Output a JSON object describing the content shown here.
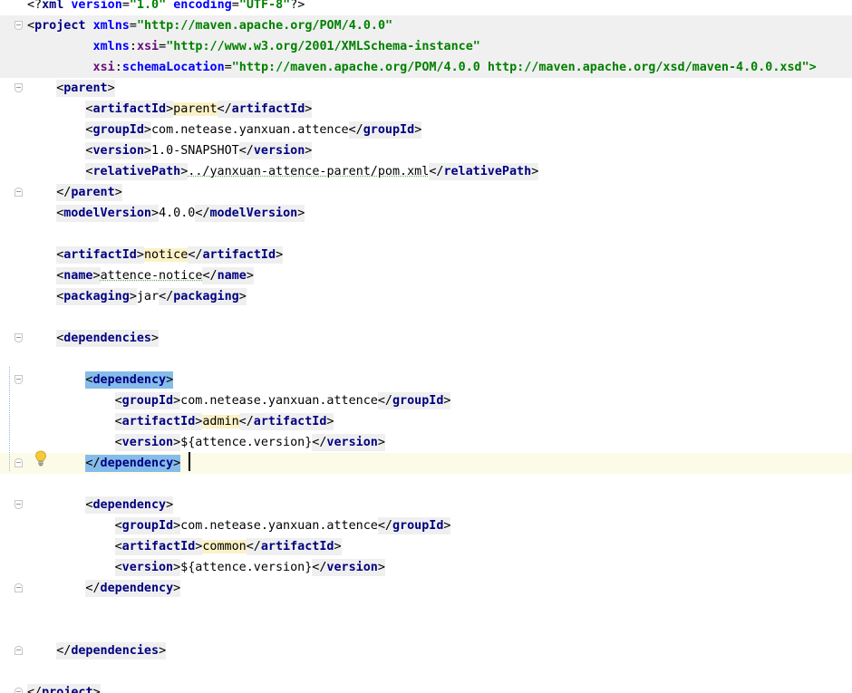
{
  "editor": {
    "file_type": "xml",
    "caret_line": 23,
    "lines": [
      {
        "fold": "none",
        "bg": false,
        "indent": 0,
        "tokens": [
          {
            "t": "<?",
            "c": "pi"
          },
          {
            "t": "xml ",
            "c": "tag"
          },
          {
            "t": "version",
            "c": "attr"
          },
          {
            "t": "=",
            "c": "pi"
          },
          {
            "t": "\"1.0\" ",
            "c": "str"
          },
          {
            "t": "encoding",
            "c": "attr"
          },
          {
            "t": "=",
            "c": "pi"
          },
          {
            "t": "\"UTF-8\"",
            "c": "str"
          },
          {
            "t": "?>",
            "c": "pi"
          }
        ]
      },
      {
        "fold": "start",
        "bg": true,
        "indent": 0,
        "tokens": [
          {
            "t": "<",
            "c": "br"
          },
          {
            "t": "project ",
            "c": "tag"
          },
          {
            "t": "xmlns",
            "c": "attr"
          },
          {
            "t": "=",
            "c": "pi"
          },
          {
            "t": "\"http://maven.apache.org/POM/4.0.0\"",
            "c": "str"
          }
        ]
      },
      {
        "fold": "none",
        "bg": true,
        "indent": 0,
        "tokens": [
          {
            "t": "         xmlns",
            "c": "attr"
          },
          {
            "t": ":",
            "c": "pi"
          },
          {
            "t": "xsi",
            "c": "ns"
          },
          {
            "t": "=",
            "c": "pi"
          },
          {
            "t": "\"http://www.w3.org/2001/XMLSchema-instance\"",
            "c": "str"
          }
        ]
      },
      {
        "fold": "none",
        "bg": true,
        "indent": 0,
        "tokens": [
          {
            "t": "         xsi",
            "c": "ns"
          },
          {
            "t": ":",
            "c": "pi"
          },
          {
            "t": "schemaLocation",
            "c": "attr"
          },
          {
            "t": "=",
            "c": "pi"
          },
          {
            "t": "\"http://maven.apache.org/POM/4.0.0 http://maven.apache.org/xsd/maven-4.0.0.xsd\">",
            "c": "str"
          }
        ]
      },
      {
        "fold": "start",
        "bg": false,
        "indent": 1,
        "box": true,
        "open": "parent"
      },
      {
        "fold": "none",
        "bg": false,
        "indent": 2,
        "elem": "artifactId",
        "value": "parent",
        "vh": true
      },
      {
        "fold": "none",
        "bg": false,
        "indent": 2,
        "elem": "groupId",
        "value": "com.netease.yanxuan.attence"
      },
      {
        "fold": "none",
        "bg": false,
        "indent": 2,
        "elem": "version",
        "value": "1.0-SNAPSHOT"
      },
      {
        "fold": "none",
        "bg": false,
        "indent": 2,
        "elem": "relativePath",
        "value": "../yanxuan-attence-parent/pom.xml",
        "squiggle": true
      },
      {
        "fold": "end",
        "bg": false,
        "indent": 1,
        "box": true,
        "close": "parent"
      },
      {
        "fold": "none",
        "bg": false,
        "indent": 1,
        "elem": "modelVersion",
        "value": "4.0.0"
      },
      {
        "fold": "none",
        "bg": false,
        "indent": 0,
        "blank": true
      },
      {
        "fold": "none",
        "bg": false,
        "indent": 1,
        "elem": "artifactId",
        "value": "notice",
        "vh": true
      },
      {
        "fold": "none",
        "bg": false,
        "indent": 1,
        "elem": "name",
        "value": "attence-notice",
        "squiggle": true
      },
      {
        "fold": "none",
        "bg": false,
        "indent": 1,
        "elem": "packaging",
        "value": "jar"
      },
      {
        "fold": "none",
        "bg": false,
        "indent": 0,
        "blank": true
      },
      {
        "fold": "start",
        "bg": false,
        "indent": 1,
        "box": true,
        "open": "dependencies"
      },
      {
        "fold": "none",
        "bg": false,
        "indent": 0,
        "blank": true
      },
      {
        "fold": "start",
        "bg": false,
        "indent": 2,
        "box": true,
        "open": "dependency",
        "sel": true
      },
      {
        "fold": "none",
        "bg": false,
        "indent": 3,
        "elem": "groupId",
        "value": "com.netease.yanxuan.attence"
      },
      {
        "fold": "none",
        "bg": false,
        "indent": 3,
        "elem": "artifactId",
        "value": "admin",
        "vh": true
      },
      {
        "fold": "none",
        "bg": false,
        "indent": 3,
        "elem": "version",
        "value": "${attence.version}"
      },
      {
        "fold": "end",
        "bg": false,
        "indent": 2,
        "box": true,
        "close": "dependency",
        "sel": true,
        "caret": true
      },
      {
        "fold": "none",
        "bg": false,
        "indent": 0,
        "blank": true
      },
      {
        "fold": "start",
        "bg": false,
        "indent": 2,
        "box": true,
        "open": "dependency"
      },
      {
        "fold": "none",
        "bg": false,
        "indent": 3,
        "elem": "groupId",
        "value": "com.netease.yanxuan.attence"
      },
      {
        "fold": "none",
        "bg": false,
        "indent": 3,
        "elem": "artifactId",
        "value": "common",
        "vh": true
      },
      {
        "fold": "none",
        "bg": false,
        "indent": 3,
        "elem": "version",
        "value": "${attence.version}"
      },
      {
        "fold": "end",
        "bg": false,
        "indent": 2,
        "box": true,
        "close": "dependency"
      },
      {
        "fold": "none",
        "bg": false,
        "indent": 0,
        "blank": true
      },
      {
        "fold": "none",
        "bg": false,
        "indent": 0,
        "blank": true
      },
      {
        "fold": "end",
        "bg": false,
        "indent": 1,
        "box": true,
        "close": "dependencies"
      },
      {
        "fold": "none",
        "bg": false,
        "indent": 0,
        "blank": true
      },
      {
        "fold": "end",
        "bg": false,
        "indent": 0,
        "box": true,
        "close": "project"
      }
    ]
  },
  "icons": {
    "intention_bulb": "lightbulb-icon",
    "fold_marker": "fold-toggle-icon"
  },
  "colors": {
    "tag": "#000080",
    "attribute": "#0000ff",
    "string": "#008000",
    "namespace": "#660e7a",
    "tag_background": "#efefef",
    "selected_tag": "#86bcea",
    "value_highlight": "#fbf1c6",
    "caret_row": "#fcfbe8"
  }
}
